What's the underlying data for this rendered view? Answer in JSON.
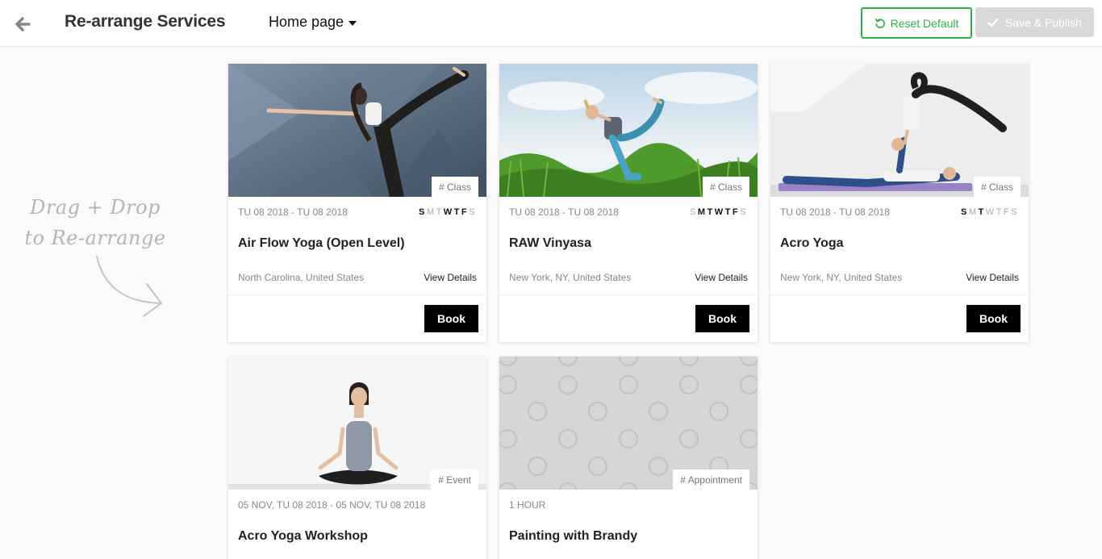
{
  "header": {
    "title": "Re-arrange Services",
    "page_select": "Home page",
    "reset_label": "Reset Default",
    "publish_label": "Save & Publish",
    "accent_color": "#2bb44a",
    "back_icon": "arrow-left-icon"
  },
  "hint": {
    "line1": "Drag + Drop",
    "line2": "to Re-arrange"
  },
  "cards": [
    {
      "tag": "# Class",
      "date": "TU 08 2018 - TU 08 2018",
      "days": [
        "S",
        "M",
        "T",
        "W",
        "T",
        "F",
        "S"
      ],
      "active_days": [
        0,
        3,
        4,
        5
      ],
      "title": "Air Flow Yoga (Open Level)",
      "location": "North Carolina, United States",
      "details": "View Details",
      "book": "Book"
    },
    {
      "tag": "# Class",
      "date": "TU 08 2018 - TU 08 2018",
      "days": [
        "S",
        "M",
        "T",
        "W",
        "T",
        "F",
        "S"
      ],
      "active_days": [
        1,
        2,
        3,
        4,
        5
      ],
      "title": "RAW Vinyasa",
      "location": "New York, NY, United States",
      "details": "View Details",
      "book": "Book"
    },
    {
      "tag": "# Class",
      "date": "TU 08 2018 - TU 08 2018",
      "days": [
        "S",
        "M",
        "T",
        "W",
        "T",
        "F",
        "S"
      ],
      "active_days": [
        0,
        2
      ],
      "title": "Acro Yoga",
      "location": "New York, NY, United States",
      "details": "View Details",
      "book": "Book"
    },
    {
      "tag": "# Event",
      "date": "05 NOV, TU 08 2018 - 05 NOV, TU 08 2018",
      "title": "Acro Yoga Workshop"
    },
    {
      "tag": "# Appointment",
      "date": "1 HOUR",
      "title": "Painting with Brandy"
    }
  ]
}
